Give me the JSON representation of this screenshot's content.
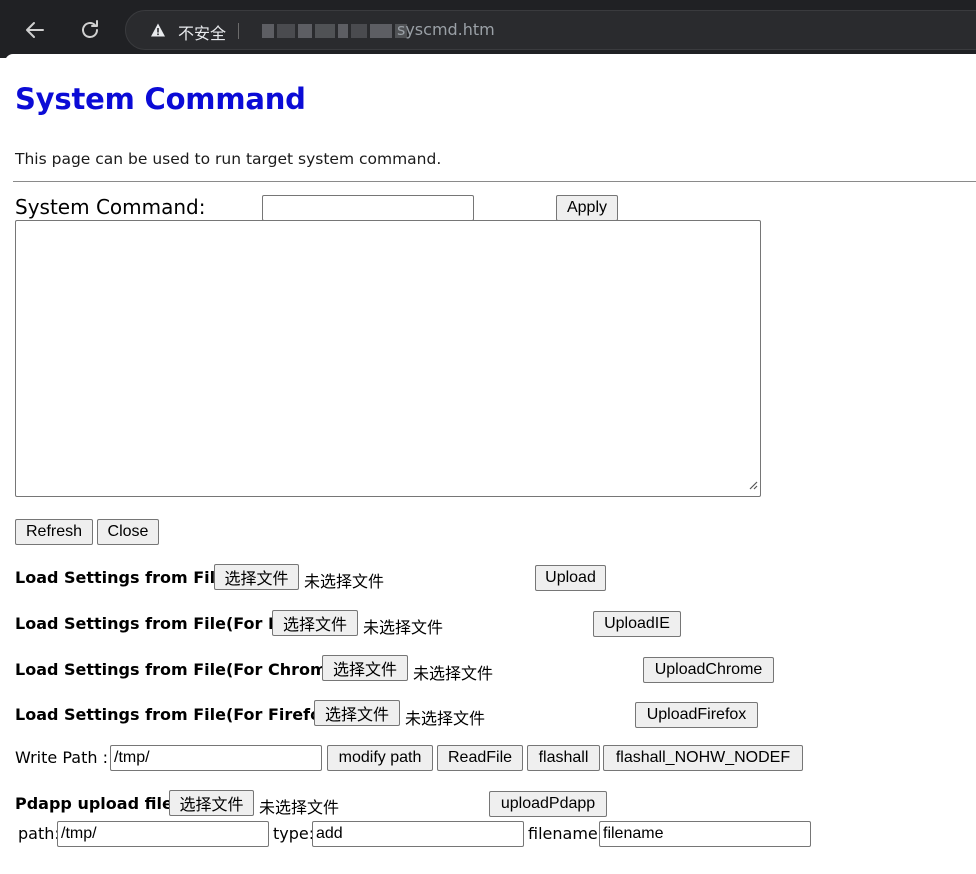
{
  "browser": {
    "insecure_label": "不安全",
    "url_tail": "syscmd.htm"
  },
  "page": {
    "title": "System Command",
    "description": "This page can be used to run target system command.",
    "command_label": "System Command:",
    "command_value": "",
    "apply_label": "Apply",
    "output_text": "",
    "refresh_label": "Refresh",
    "close_label": "Close",
    "choose_file_label": "选择文件",
    "no_file_label": "未选择文件",
    "loaders": [
      {
        "label": "Load Settings from File:",
        "button": "Upload"
      },
      {
        "label": "Load Settings from File(For IE):",
        "button": "UploadIE"
      },
      {
        "label": "Load Settings from File(For Chrome):",
        "button": "UploadChrome"
      },
      {
        "label": "Load Settings from File(For Firefox):",
        "button": "UploadFirefox"
      }
    ],
    "write_path": {
      "label": "Write Path :",
      "value": "/tmp/",
      "buttons": [
        "modify path",
        "ReadFile",
        "flashall",
        "flashall_NOHW_NODEF"
      ]
    },
    "pdapp": {
      "label": "Pdapp upload file:",
      "button": "uploadPdapp",
      "path_label": "path:",
      "path_value": "/tmp/",
      "type_label": "type:",
      "type_value": "add",
      "filename_label": "filename:",
      "filename_value": "filename"
    }
  }
}
